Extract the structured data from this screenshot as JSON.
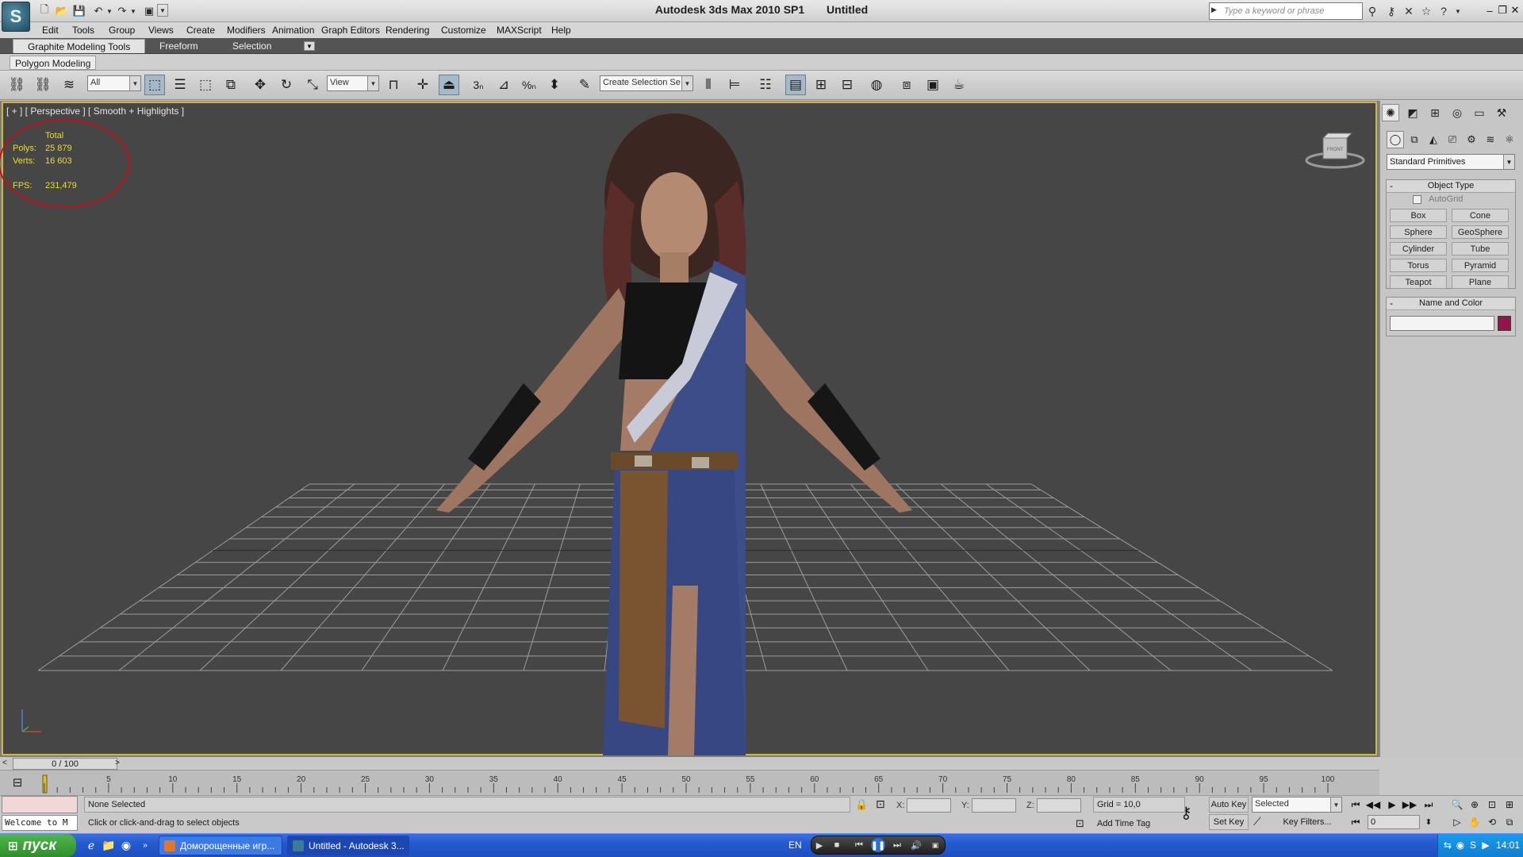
{
  "window": {
    "title": "Autodesk 3ds Max  2010 SP1",
    "document": "Untitled",
    "search_placeholder": "Type a keyword or phrase",
    "logo_glyph": "S"
  },
  "menu": [
    "Edit",
    "Tools",
    "Group",
    "Views",
    "Create",
    "Modifiers",
    "Animation",
    "Graph Editors",
    "Rendering",
    "Customize",
    "MAXScript",
    "Help"
  ],
  "ribbon": {
    "tabs": [
      "Graphite Modeling Tools",
      "Freeform",
      "Selection"
    ],
    "active_tab": "Graphite Modeling Tools",
    "panel_tab": "Polygon Modeling"
  },
  "toolbar": {
    "selection_filter": "All",
    "reference_coord": "View",
    "named_selection": "Create Selection Se"
  },
  "viewport": {
    "label": "[ + ] [ Perspective ] [ Smooth + Highlights ]",
    "stats": {
      "header": "Total",
      "polys_label": "Polys:",
      "polys_value": "25 879",
      "verts_label": "Verts:",
      "verts_value": "16 603",
      "fps_label": "FPS:",
      "fps_value": "231,479"
    },
    "viewcube_label": "FRONT",
    "border_color": "#d4b63a",
    "background_color": "#464646",
    "annotation_color": "#c0101a"
  },
  "command_panel": {
    "category": "Standard Primitives",
    "object_type_title": "Object Type",
    "autogrid_label": "AutoGrid",
    "primitives": [
      "Box",
      "Cone",
      "Sphere",
      "GeoSphere",
      "Cylinder",
      "Tube",
      "Torus",
      "Pyramid",
      "Teapot",
      "Plane"
    ],
    "name_color_title": "Name and Color",
    "object_color": "#96134a"
  },
  "timeline": {
    "slider_text": "0 / 100",
    "ticks": [
      "5",
      "10",
      "15",
      "20",
      "25",
      "30",
      "35",
      "40",
      "45",
      "50",
      "55",
      "60",
      "65",
      "70",
      "75",
      "80",
      "85",
      "90",
      "95",
      "100"
    ]
  },
  "status": {
    "listener_text": "Welcome to M",
    "selection": "None Selected",
    "prompt": "Click or click-and-drag to select objects",
    "x_label": "X:",
    "y_label": "Y:",
    "z_label": "Z:",
    "grid": "Grid = 10,0",
    "add_time_tag": "Add Time Tag",
    "auto_key": "Auto Key",
    "set_key": "Set Key",
    "key_mode": "Selected",
    "key_filters": "Key Filters...",
    "current_frame": "0"
  },
  "taskbar": {
    "start_label": "пуск",
    "items": [
      "Доморощенные игр...",
      "Untitled - Autodesk 3..."
    ],
    "language": "EN",
    "clock": "14:01"
  }
}
